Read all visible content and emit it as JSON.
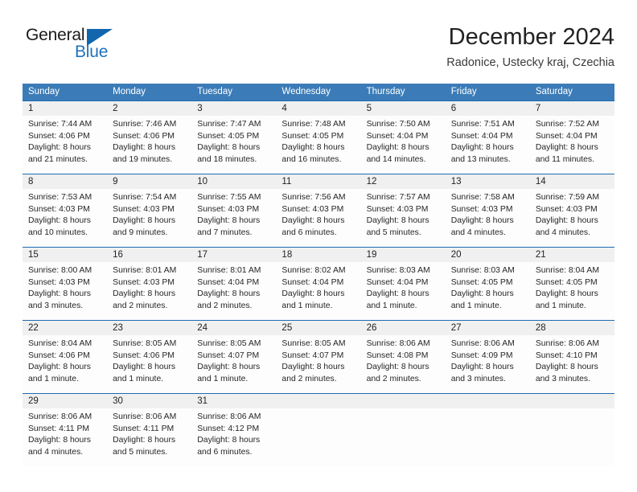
{
  "brand": {
    "name_part1": "General",
    "name_part2": "Blue",
    "triangle_color": "#1266ad"
  },
  "header": {
    "title": "December 2024",
    "subtitle": "Radonice, Ustecky kraj, Czechia"
  },
  "theme": {
    "header_blue": "#3b7cb8",
    "rule_blue": "#1f6cb0",
    "daynum_band": "#f0f0f0",
    "cell_bg": "#fdfdfd"
  },
  "weekdays": [
    "Sunday",
    "Monday",
    "Tuesday",
    "Wednesday",
    "Thursday",
    "Friday",
    "Saturday"
  ],
  "weeks": [
    [
      {
        "day": "1",
        "sunrise": "Sunrise: 7:44 AM",
        "sunset": "Sunset: 4:06 PM",
        "daylight1": "Daylight: 8 hours",
        "daylight2": "and 21 minutes."
      },
      {
        "day": "2",
        "sunrise": "Sunrise: 7:46 AM",
        "sunset": "Sunset: 4:06 PM",
        "daylight1": "Daylight: 8 hours",
        "daylight2": "and 19 minutes."
      },
      {
        "day": "3",
        "sunrise": "Sunrise: 7:47 AM",
        "sunset": "Sunset: 4:05 PM",
        "daylight1": "Daylight: 8 hours",
        "daylight2": "and 18 minutes."
      },
      {
        "day": "4",
        "sunrise": "Sunrise: 7:48 AM",
        "sunset": "Sunset: 4:05 PM",
        "daylight1": "Daylight: 8 hours",
        "daylight2": "and 16 minutes."
      },
      {
        "day": "5",
        "sunrise": "Sunrise: 7:50 AM",
        "sunset": "Sunset: 4:04 PM",
        "daylight1": "Daylight: 8 hours",
        "daylight2": "and 14 minutes."
      },
      {
        "day": "6",
        "sunrise": "Sunrise: 7:51 AM",
        "sunset": "Sunset: 4:04 PM",
        "daylight1": "Daylight: 8 hours",
        "daylight2": "and 13 minutes."
      },
      {
        "day": "7",
        "sunrise": "Sunrise: 7:52 AM",
        "sunset": "Sunset: 4:04 PM",
        "daylight1": "Daylight: 8 hours",
        "daylight2": "and 11 minutes."
      }
    ],
    [
      {
        "day": "8",
        "sunrise": "Sunrise: 7:53 AM",
        "sunset": "Sunset: 4:03 PM",
        "daylight1": "Daylight: 8 hours",
        "daylight2": "and 10 minutes."
      },
      {
        "day": "9",
        "sunrise": "Sunrise: 7:54 AM",
        "sunset": "Sunset: 4:03 PM",
        "daylight1": "Daylight: 8 hours",
        "daylight2": "and 9 minutes."
      },
      {
        "day": "10",
        "sunrise": "Sunrise: 7:55 AM",
        "sunset": "Sunset: 4:03 PM",
        "daylight1": "Daylight: 8 hours",
        "daylight2": "and 7 minutes."
      },
      {
        "day": "11",
        "sunrise": "Sunrise: 7:56 AM",
        "sunset": "Sunset: 4:03 PM",
        "daylight1": "Daylight: 8 hours",
        "daylight2": "and 6 minutes."
      },
      {
        "day": "12",
        "sunrise": "Sunrise: 7:57 AM",
        "sunset": "Sunset: 4:03 PM",
        "daylight1": "Daylight: 8 hours",
        "daylight2": "and 5 minutes."
      },
      {
        "day": "13",
        "sunrise": "Sunrise: 7:58 AM",
        "sunset": "Sunset: 4:03 PM",
        "daylight1": "Daylight: 8 hours",
        "daylight2": "and 4 minutes."
      },
      {
        "day": "14",
        "sunrise": "Sunrise: 7:59 AM",
        "sunset": "Sunset: 4:03 PM",
        "daylight1": "Daylight: 8 hours",
        "daylight2": "and 4 minutes."
      }
    ],
    [
      {
        "day": "15",
        "sunrise": "Sunrise: 8:00 AM",
        "sunset": "Sunset: 4:03 PM",
        "daylight1": "Daylight: 8 hours",
        "daylight2": "and 3 minutes."
      },
      {
        "day": "16",
        "sunrise": "Sunrise: 8:01 AM",
        "sunset": "Sunset: 4:03 PM",
        "daylight1": "Daylight: 8 hours",
        "daylight2": "and 2 minutes."
      },
      {
        "day": "17",
        "sunrise": "Sunrise: 8:01 AM",
        "sunset": "Sunset: 4:04 PM",
        "daylight1": "Daylight: 8 hours",
        "daylight2": "and 2 minutes."
      },
      {
        "day": "18",
        "sunrise": "Sunrise: 8:02 AM",
        "sunset": "Sunset: 4:04 PM",
        "daylight1": "Daylight: 8 hours",
        "daylight2": "and 1 minute."
      },
      {
        "day": "19",
        "sunrise": "Sunrise: 8:03 AM",
        "sunset": "Sunset: 4:04 PM",
        "daylight1": "Daylight: 8 hours",
        "daylight2": "and 1 minute."
      },
      {
        "day": "20",
        "sunrise": "Sunrise: 8:03 AM",
        "sunset": "Sunset: 4:05 PM",
        "daylight1": "Daylight: 8 hours",
        "daylight2": "and 1 minute."
      },
      {
        "day": "21",
        "sunrise": "Sunrise: 8:04 AM",
        "sunset": "Sunset: 4:05 PM",
        "daylight1": "Daylight: 8 hours",
        "daylight2": "and 1 minute."
      }
    ],
    [
      {
        "day": "22",
        "sunrise": "Sunrise: 8:04 AM",
        "sunset": "Sunset: 4:06 PM",
        "daylight1": "Daylight: 8 hours",
        "daylight2": "and 1 minute."
      },
      {
        "day": "23",
        "sunrise": "Sunrise: 8:05 AM",
        "sunset": "Sunset: 4:06 PM",
        "daylight1": "Daylight: 8 hours",
        "daylight2": "and 1 minute."
      },
      {
        "day": "24",
        "sunrise": "Sunrise: 8:05 AM",
        "sunset": "Sunset: 4:07 PM",
        "daylight1": "Daylight: 8 hours",
        "daylight2": "and 1 minute."
      },
      {
        "day": "25",
        "sunrise": "Sunrise: 8:05 AM",
        "sunset": "Sunset: 4:07 PM",
        "daylight1": "Daylight: 8 hours",
        "daylight2": "and 2 minutes."
      },
      {
        "day": "26",
        "sunrise": "Sunrise: 8:06 AM",
        "sunset": "Sunset: 4:08 PM",
        "daylight1": "Daylight: 8 hours",
        "daylight2": "and 2 minutes."
      },
      {
        "day": "27",
        "sunrise": "Sunrise: 8:06 AM",
        "sunset": "Sunset: 4:09 PM",
        "daylight1": "Daylight: 8 hours",
        "daylight2": "and 3 minutes."
      },
      {
        "day": "28",
        "sunrise": "Sunrise: 8:06 AM",
        "sunset": "Sunset: 4:10 PM",
        "daylight1": "Daylight: 8 hours",
        "daylight2": "and 3 minutes."
      }
    ],
    [
      {
        "day": "29",
        "sunrise": "Sunrise: 8:06 AM",
        "sunset": "Sunset: 4:11 PM",
        "daylight1": "Daylight: 8 hours",
        "daylight2": "and 4 minutes."
      },
      {
        "day": "30",
        "sunrise": "Sunrise: 8:06 AM",
        "sunset": "Sunset: 4:11 PM",
        "daylight1": "Daylight: 8 hours",
        "daylight2": "and 5 minutes."
      },
      {
        "day": "31",
        "sunrise": "Sunrise: 8:06 AM",
        "sunset": "Sunset: 4:12 PM",
        "daylight1": "Daylight: 8 hours",
        "daylight2": "and 6 minutes."
      },
      {
        "day": "",
        "sunrise": "",
        "sunset": "",
        "daylight1": "",
        "daylight2": ""
      },
      {
        "day": "",
        "sunrise": "",
        "sunset": "",
        "daylight1": "",
        "daylight2": ""
      },
      {
        "day": "",
        "sunrise": "",
        "sunset": "",
        "daylight1": "",
        "daylight2": ""
      },
      {
        "day": "",
        "sunrise": "",
        "sunset": "",
        "daylight1": "",
        "daylight2": ""
      }
    ]
  ]
}
